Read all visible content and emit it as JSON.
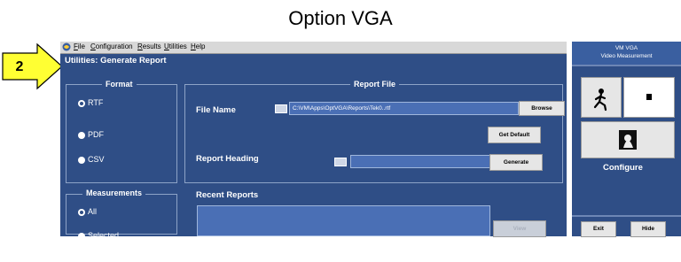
{
  "page_title": "Option VGA",
  "callout_number": "2",
  "app": {
    "menu": [
      "File",
      "Configuration",
      "Results",
      "Utilities",
      "Help"
    ],
    "utilities_title": "Utilities: Generate Report",
    "format": {
      "heading": "Format",
      "options": [
        {
          "label": "RTF",
          "selected": true
        },
        {
          "label": "PDF",
          "selected": false
        },
        {
          "label": "CSV",
          "selected": false
        }
      ]
    },
    "measurements": {
      "heading": "Measurements",
      "options": [
        {
          "label": "All",
          "selected": true
        },
        {
          "label": "Selected",
          "selected": false
        }
      ]
    },
    "report_file": {
      "heading": "Report File",
      "file_name_label": "File Name",
      "file_name_value": "C:\\VM\\Apps\\OptVGA\\Reports\\Tek0..rtf",
      "browse_label": "Browse",
      "get_default_label": "Get Default",
      "report_heading_label": "Report Heading",
      "report_heading_value": "",
      "generate_label": "Generate"
    },
    "recent_reports": {
      "heading": "Recent Reports",
      "view_label": "View"
    }
  },
  "side": {
    "title_line1": "VM VGA",
    "title_line2": "Video Measurement",
    "configure_label": "Configure",
    "exit_label": "Exit",
    "hide_label": "Hide"
  },
  "colors": {
    "panel_bg": "#2f4e86",
    "field_bg": "#4a6fb5",
    "callout_fill": "#ffff33"
  }
}
